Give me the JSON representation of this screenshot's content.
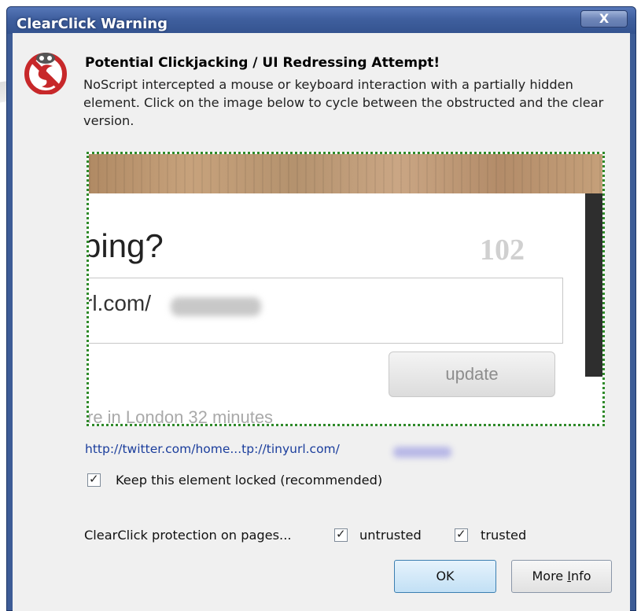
{
  "window": {
    "title": "ClearClick Warning",
    "close_label": "X"
  },
  "heading": "Potential Clickjacking / UI Redressing Attempt!",
  "description": "NoScript intercepted a mouse or keyboard interaction with a partially hidden element. Click on the image below to cycle between the obstructed and the clear version.",
  "preview": {
    "heading": "bing?",
    "counter": "102",
    "input_text": "rl.com/",
    "button_label": "update",
    "tail_text": "re in London 32 minutes"
  },
  "url": "http://twitter.com/home...tp://tinyurl.com/",
  "keep_locked_label": "Keep this element locked (recommended)",
  "keep_locked_checked": true,
  "protection": {
    "label": "ClearClick protection on pages...",
    "untrusted_label": "untrusted",
    "untrusted_checked": true,
    "trusted_label": "trusted",
    "trusted_checked": true
  },
  "buttons": {
    "ok": "OK",
    "more_info_prefix": "More ",
    "more_info_underlined": "I",
    "more_info_suffix": "nfo"
  },
  "colors": {
    "titlebar": "#3f5f9e",
    "link": "#1a3d9c",
    "preview_border": "#2f8a2a"
  },
  "icons": [
    "noscript-logo-icon",
    "close-icon",
    "checkmark-icon"
  ]
}
